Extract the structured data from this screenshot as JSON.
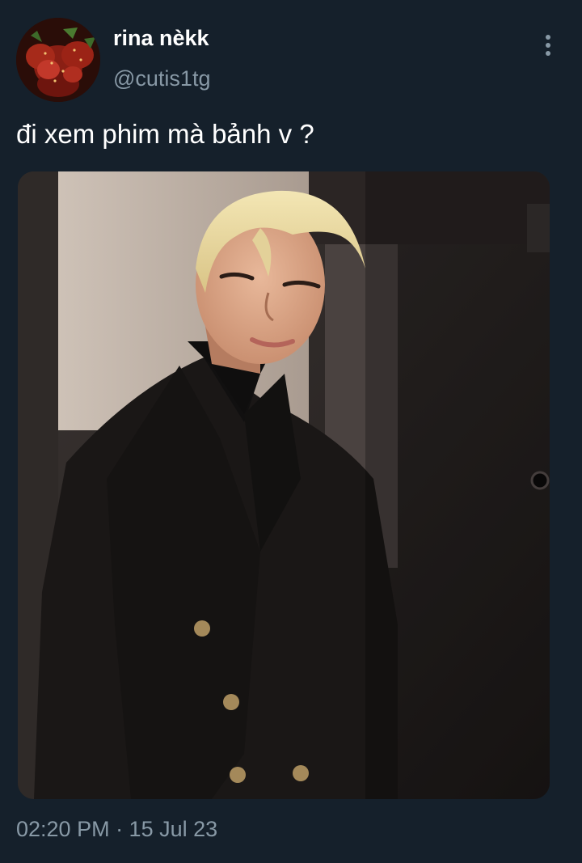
{
  "tweet": {
    "display_name": "rina nèkk",
    "handle": "@cutis1tg",
    "text": "đi xem phim mà bảnh v ?",
    "timestamp": "02:20 PM · 15 Jul 23"
  },
  "icons": {
    "more": "more-vertical-icon",
    "avatar": "strawberry-avatar"
  },
  "colors": {
    "background": "#15202b",
    "primary_text": "#ffffff",
    "secondary_text": "#8899a6"
  }
}
